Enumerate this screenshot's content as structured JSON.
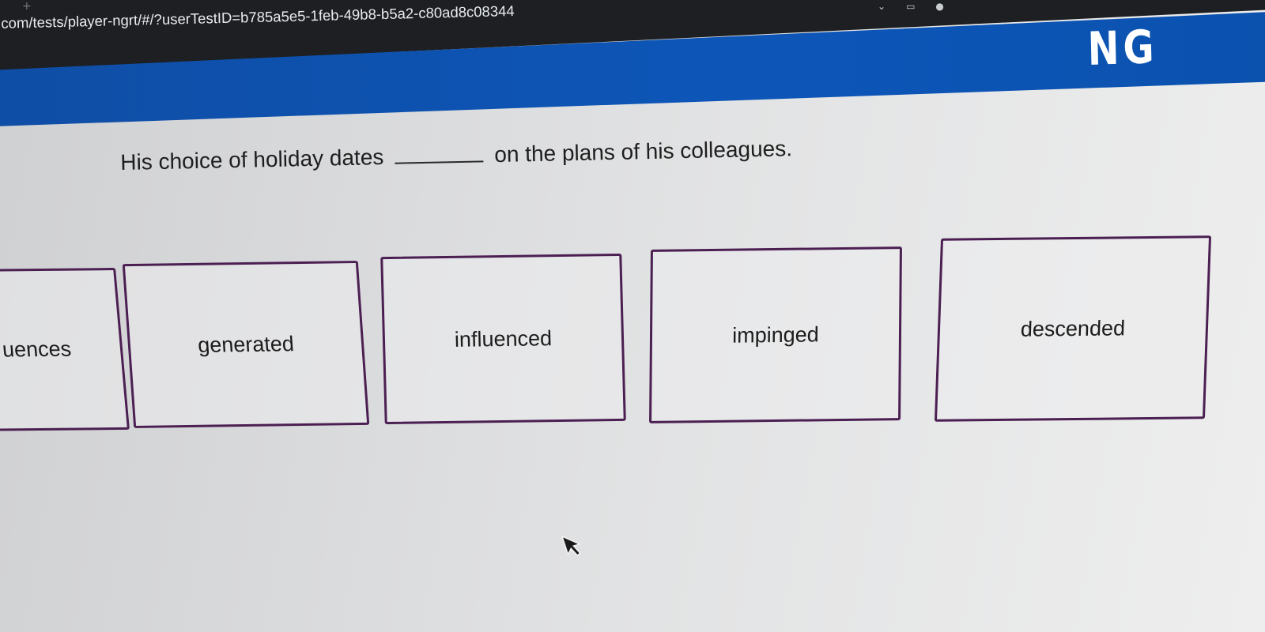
{
  "browser": {
    "url_text": ".com/tests/player-ngrt/#/?userTestID=b785a5e5-1feb-49b8-b5a2-c80ad8c08344",
    "tab_controls": [
      "⌄",
      "▭",
      "●"
    ]
  },
  "header": {
    "logo_text": "NG"
  },
  "question": {
    "before_blank": "His choice of holiday dates",
    "after_blank": "on the plans of his colleagues."
  },
  "options": [
    {
      "label": "uences"
    },
    {
      "label": "generated"
    },
    {
      "label": "influenced"
    },
    {
      "label": "impinged"
    },
    {
      "label": "descended"
    }
  ],
  "colors": {
    "header_blue": "#0d56b8",
    "browser_dark": "#1d1f22",
    "option_border": "#4b1f52",
    "page_background": "#e2e3e4"
  },
  "icons": {
    "new_tab": "plus-icon",
    "pointer": "mouse-cursor-icon"
  }
}
